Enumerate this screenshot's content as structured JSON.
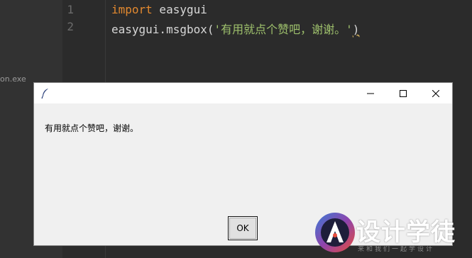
{
  "sidebar": {
    "file_label": "on.exe"
  },
  "editor": {
    "lines": [
      {
        "number": "1",
        "keyword": "import",
        "rest": " easygui"
      },
      {
        "number": "2",
        "prefix": "easygui.msgbox(",
        "string": "'有用就点个赞吧，谢谢。'",
        "suffix": ")"
      }
    ],
    "colors": {
      "keyword": "#e3892f",
      "string": "#9ec06c",
      "text": "#d8d8d8",
      "background": "#2b2b2b"
    }
  },
  "dialog": {
    "title_icon": "feather-icon",
    "buttons": {
      "minimize": "minimize-icon",
      "maximize": "maximize-icon",
      "close": "close-icon"
    },
    "message": "有用就点个赞吧，谢谢。",
    "ok_label": "OK"
  },
  "watermark": {
    "brand": "设计学徒",
    "slogan": "来和我们一起学设计"
  }
}
